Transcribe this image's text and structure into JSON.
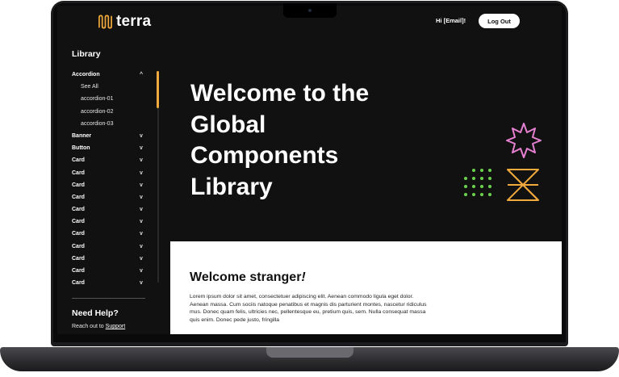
{
  "header": {
    "brand": "terra",
    "greeting": "Hi [Email]!",
    "logout_label": "Log Out"
  },
  "sidebar": {
    "title": "Library",
    "items": [
      {
        "label": "Accordion",
        "chevron": "^",
        "expanded": true
      },
      {
        "label": "See All"
      },
      {
        "label": "accordion-01"
      },
      {
        "label": "accordion-02"
      },
      {
        "label": "accordion-03"
      },
      {
        "label": "Banner",
        "chevron": "v"
      },
      {
        "label": "Button",
        "chevron": "v"
      },
      {
        "label": "Card",
        "chevron": "v"
      },
      {
        "label": "Card",
        "chevron": "v"
      },
      {
        "label": "Card",
        "chevron": "v"
      },
      {
        "label": "Card",
        "chevron": "v"
      },
      {
        "label": "Card",
        "chevron": "v"
      },
      {
        "label": "Card",
        "chevron": "v"
      },
      {
        "label": "Card",
        "chevron": "v"
      },
      {
        "label": "Card",
        "chevron": "v"
      },
      {
        "label": "Card",
        "chevron": "v"
      },
      {
        "label": "Card",
        "chevron": "v"
      },
      {
        "label": "Card",
        "chevron": "v"
      }
    ],
    "help_title": "Need Help?",
    "help_text": "Reach out to",
    "help_link": "Support"
  },
  "hero": {
    "title_lines": [
      "Welcome to the",
      "Global",
      "Components",
      "Library"
    ]
  },
  "content": {
    "title": "Welcome stranger",
    "title_emphasis": "!",
    "body": "Lorem ipsum dolor sit amet, consectetuer adipiscing elit. Aenean commodo ligula eget dolor. Aenean massa. Cum sociis natoque penatibus et magnis dis parturient montes, nascetur ridiculus mus. Donec quam felis, ultricies nec, pellentesque eu, pretium quis, sem. Nulla consequat massa quis enim. Donec pede justo, fringilla"
  },
  "colors": {
    "accent_orange": "#f0a93c",
    "accent_pink": "#e680d2",
    "accent_green": "#6bd34a",
    "background": "#111111"
  },
  "icons": [
    "terra-logo-icon",
    "chevron-up-icon",
    "chevron-down-icon",
    "sparkle-shape-icon",
    "dot-grid-icon",
    "hourglass-shape-icon"
  ]
}
